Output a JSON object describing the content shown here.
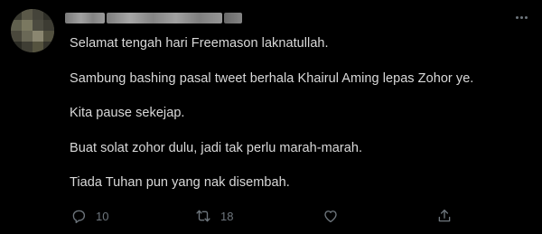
{
  "tweet": {
    "paragraphs": [
      "Selamat tengah hari Freemason laknatullah.",
      "Sambung bashing pasal tweet berhala Khairul Aming lepas Zohor ye.",
      "Kita pause sekejap.",
      "Buat solat zohor dulu, jadi tak perlu marah-marah.",
      "Tiada Tuhan pun yang nak disembah."
    ],
    "actions": {
      "reply_count": "10",
      "retweet_count": "18",
      "like_count": "",
      "share_count": ""
    }
  },
  "icons": {
    "reply": "reply-icon",
    "retweet": "retweet-icon",
    "like": "heart-icon",
    "share": "share-icon",
    "more": "more-icon"
  },
  "colors": {
    "background": "#000000",
    "text": "#d9d9d9",
    "muted": "#6e767d"
  }
}
